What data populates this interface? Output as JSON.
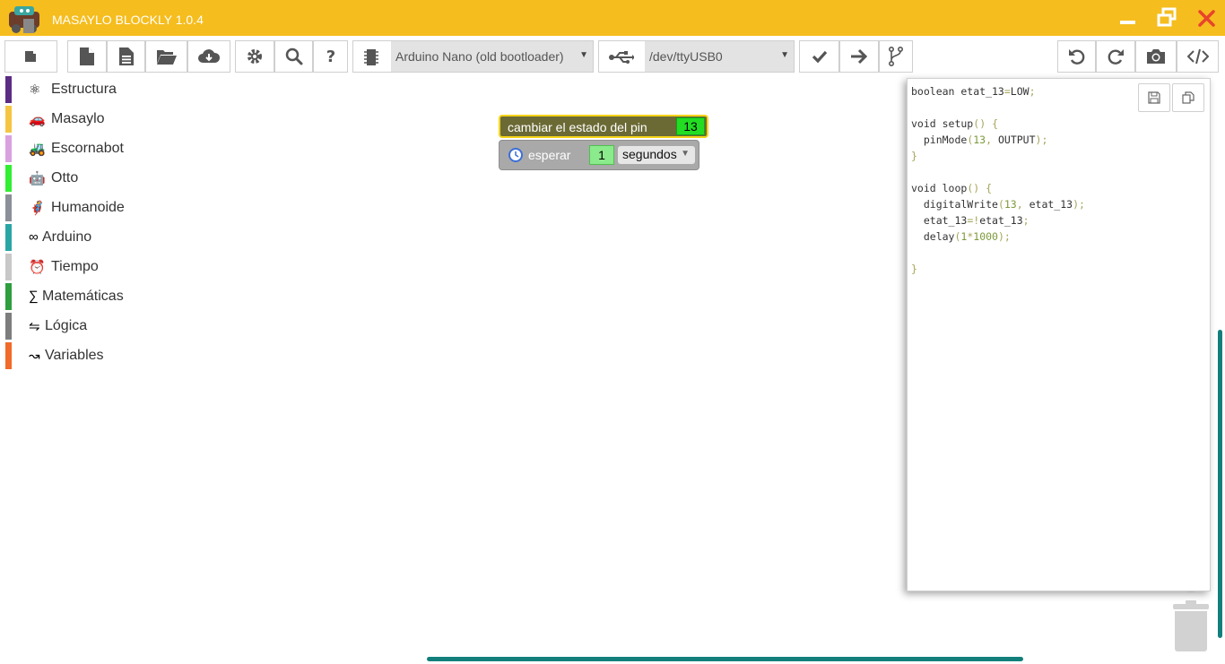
{
  "app": {
    "title": "MASAYLO BLOCKLY 1.0.4",
    "accent_color": "#f5bd1e",
    "logo_icon": "robot-logo-icon"
  },
  "window_controls": {
    "minimize_icon": "minimize-icon",
    "restore_icon": "restore-icon",
    "close_icon": "close-icon"
  },
  "toolbar": {
    "board_select": {
      "value": "Arduino Nano (old bootloader)",
      "icon": "chip-icon"
    },
    "port_select": {
      "value": "/dev/ttyUSB0",
      "icon": "usb-icon"
    },
    "left_icons": [
      "blocks-icon",
      "new-file-icon",
      "file-text-icon",
      "open-folder-icon",
      "cloud-download-icon",
      "gear-icon",
      "search-icon",
      "help-icon"
    ],
    "action_icons": [
      "check-icon",
      "arrow-right-icon",
      "git-branch-icon"
    ],
    "right_icons": [
      "undo-icon",
      "redo-icon",
      "camera-icon",
      "code-icon"
    ]
  },
  "categories": [
    {
      "label": "Estructura",
      "icon": "⚛",
      "color": "#5b2c83"
    },
    {
      "label": "Masaylo",
      "icon": "🚗",
      "color": "#f5c542"
    },
    {
      "label": "Escornabot",
      "icon": "🚜",
      "color": "#d9a1e0"
    },
    {
      "label": "Otto",
      "icon": "🤖",
      "color": "#33ee33"
    },
    {
      "label": "Humanoide",
      "icon": "🦸",
      "color": "#8a8f98"
    },
    {
      "label": "Arduino",
      "icon": "∞",
      "color": "#2aa5a5"
    },
    {
      "label": "Tiempo",
      "icon": "⏰",
      "color": "#c8c8c8"
    },
    {
      "label": "Matemáticas",
      "icon": "∑",
      "color": "#2e9e3e"
    },
    {
      "label": "Lógica",
      "icon": "⇋",
      "color": "#7d7d7d"
    },
    {
      "label": "Variables",
      "icon": "↝",
      "color": "#f06a2a"
    }
  ],
  "blocks": {
    "toggle_pin": {
      "label": "cambiar el estado del pin",
      "pin": "13"
    },
    "wait": {
      "label": "esperar",
      "value": "1",
      "unit": "segundos",
      "icon": "clock-icon"
    }
  },
  "code": {
    "lines": [
      "boolean etat_13=LOW;",
      "",
      "void setup() {",
      "  pinMode(13, OUTPUT);",
      "}",
      "",
      "void loop() {",
      "  digitalWrite(13, etat_13);",
      "  etat_13=!etat_13;",
      "  delay(1*1000);",
      "",
      "}"
    ],
    "save_icon": "save-icon",
    "copy_icon": "copy-icon"
  },
  "workspace": {
    "trash_icon": "trash-icon",
    "zoom_icons": [
      "zoom-reset-icon",
      "zoom-in-icon",
      "zoom-out-icon"
    ]
  }
}
